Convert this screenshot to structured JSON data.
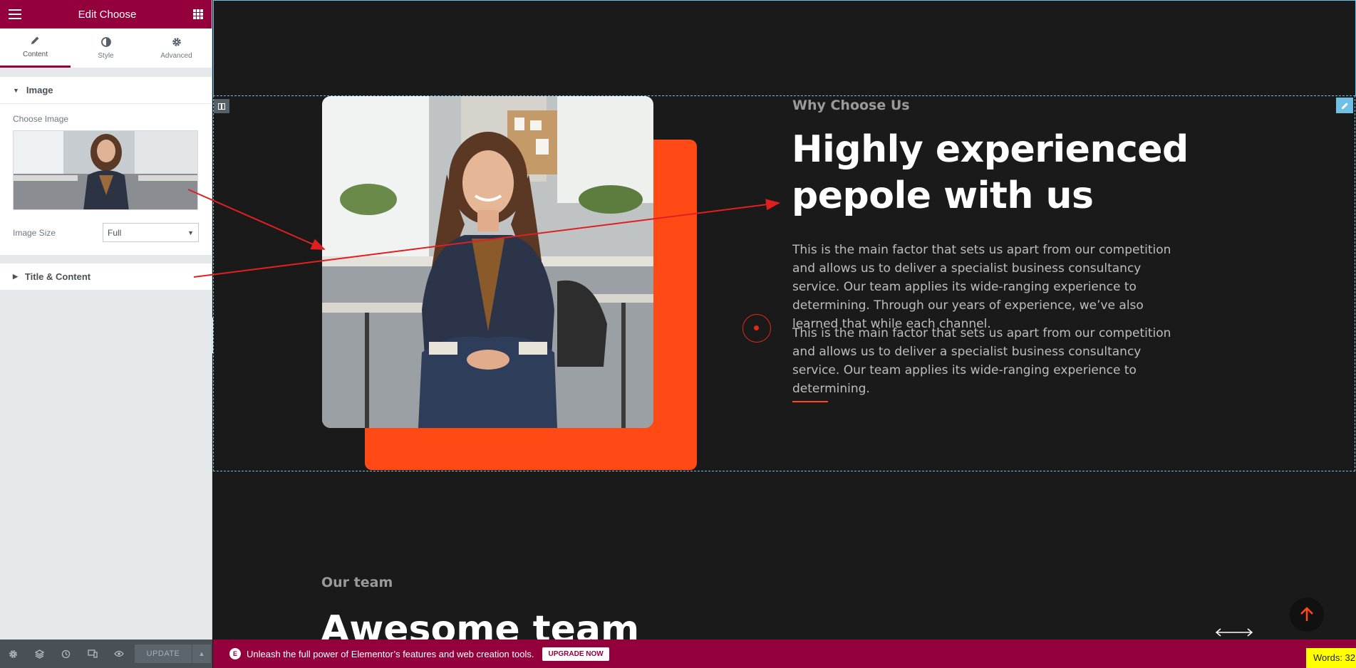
{
  "panel": {
    "title": "Edit Choose",
    "tabs": [
      {
        "label": "Content",
        "icon": "pencil-icon"
      },
      {
        "label": "Style",
        "icon": "contrast-icon"
      },
      {
        "label": "Advanced",
        "icon": "gear-icon"
      }
    ],
    "image_section": {
      "title": "Image",
      "choose_image_label": "Choose Image",
      "image_size_label": "Image Size",
      "image_size_value": "Full"
    },
    "title_content_section": {
      "title": "Title & Content"
    },
    "footer": {
      "update_label": "UPDATE"
    }
  },
  "content": {
    "subtitle": "Why Choose Us",
    "heading": "Highly experienced pepole with us",
    "paragraph1": "This is the main factor that sets us apart from our competition and allows us to deliver a specialist business consultancy service. Our team applies its wide-ranging experience to determining. Through our years of experience, we’ve also learned that while each channel.",
    "paragraph2": "This is the main factor that sets us apart from our competition and allows us to deliver a specialist business consultancy service. Our team applies its wide-ranging experience to determining.",
    "team_subtitle": "Our team",
    "team_heading": "Awesome team"
  },
  "promo": {
    "message": "Unleash the full power of Elementor’s features and web creation tools.",
    "upgrade_label": "UPGRADE NOW"
  },
  "word_count": "Words: 32",
  "colors": {
    "brand": "#93003c",
    "accent": "#ff4a16",
    "canvas_bg": "#1a1a1a",
    "selection": "#6ec1e4",
    "annotation": "#e02020"
  }
}
